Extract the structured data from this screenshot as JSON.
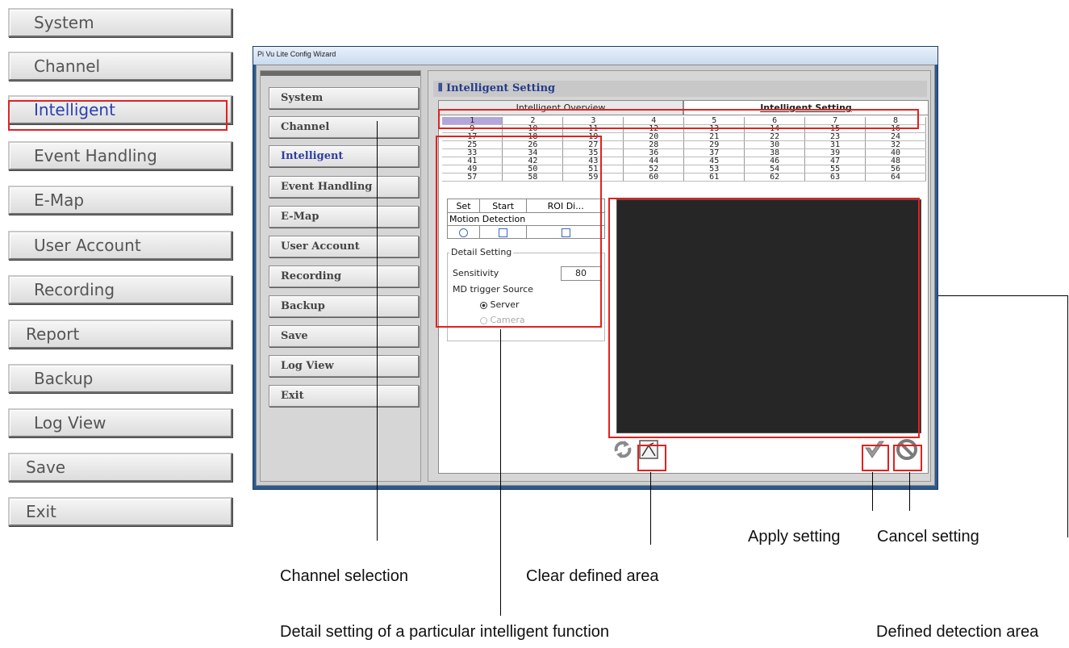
{
  "left_menu": {
    "items": [
      "System",
      "Channel",
      "Intelligent",
      "Event Handling",
      "E-Map",
      "User Account",
      "Recording",
      "Report",
      "Backup",
      "Log View",
      "Save",
      "Exit"
    ],
    "active": "Intelligent"
  },
  "window": {
    "title": "Pi Vu Lite Config Wizard",
    "side_menu": [
      "System",
      "Channel",
      "Intelligent",
      "Event Handling",
      "E-Map",
      "User Account",
      "Recording",
      "Backup",
      "Save",
      "Log View",
      "Exit"
    ],
    "side_active": "Intelligent",
    "header": "Intelligent Setting",
    "tabs": [
      "Intelligent Overview",
      "Intelligent Setting"
    ],
    "active_tab": "Intelligent Setting",
    "channels": [
      [
        "1",
        "2",
        "3",
        "4",
        "5",
        "6",
        "7",
        "8"
      ],
      [
        "9",
        "10",
        "11",
        "12",
        "13",
        "14",
        "15",
        "16"
      ],
      [
        "17",
        "18",
        "19",
        "20",
        "21",
        "22",
        "23",
        "24"
      ],
      [
        "25",
        "26",
        "27",
        "28",
        "29",
        "30",
        "31",
        "32"
      ],
      [
        "33",
        "34",
        "35",
        "36",
        "37",
        "38",
        "39",
        "40"
      ],
      [
        "41",
        "42",
        "43",
        "44",
        "45",
        "46",
        "47",
        "48"
      ],
      [
        "49",
        "50",
        "51",
        "52",
        "53",
        "54",
        "55",
        "56"
      ],
      [
        "57",
        "58",
        "59",
        "60",
        "61",
        "62",
        "63",
        "64"
      ]
    ],
    "selected_channel": "1",
    "function_table": {
      "headers": [
        "Set",
        "Start",
        "ROI Di..."
      ],
      "row_label": "Motion Detection"
    },
    "detail": {
      "legend": "Detail Setting",
      "sensitivity_label": "Sensitivity",
      "sensitivity_value": "80",
      "trigger_label": "MD trigger Source",
      "option_server": "Server",
      "option_camera": "Camera",
      "selected_source": "Server"
    }
  },
  "callouts": {
    "channel_selection": "Channel selection",
    "clear_area": "Clear defined area",
    "apply": "Apply setting",
    "cancel": "Cancel setting",
    "detail_setting": "Detail setting of a particular intelligent function",
    "detection_area": "Defined detection area"
  },
  "colors": {
    "highlight": "#e32020",
    "active_text": "#2a3fb0",
    "preview_bg": "#262626"
  }
}
